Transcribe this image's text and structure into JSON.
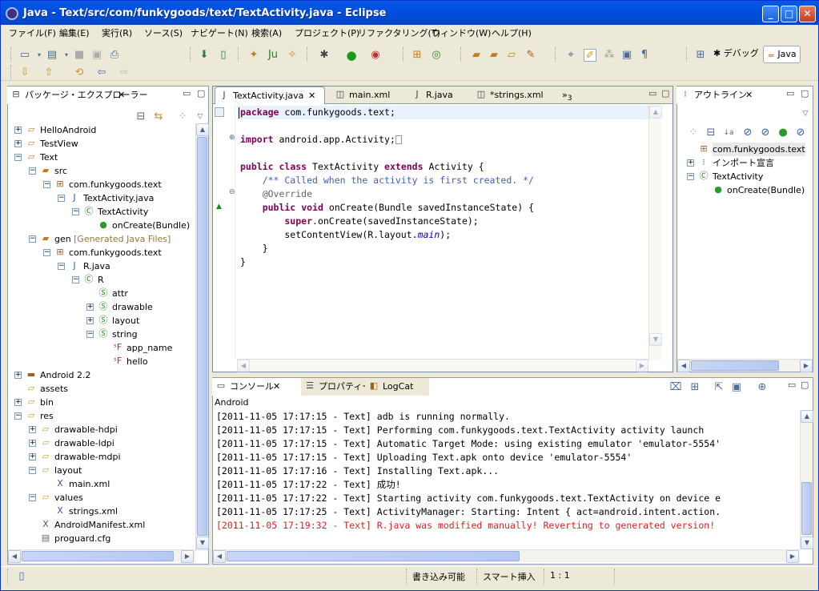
{
  "window": {
    "title": "Java - Text/src/com/funkygoods/text/TextActivity.java - Eclipse",
    "minimize": "_",
    "maximize": "□",
    "close": "✕"
  },
  "menu": [
    "ファイル(F)",
    "編集(E)",
    "実行(R)",
    "ソース(S)",
    "ナビゲート(N)",
    "検索(A)",
    "プロジェクト(P)",
    "リファクタリング(T)",
    "ウィンドウ(W)",
    "ヘルプ(H)"
  ],
  "perspectives": {
    "debug": "デバッグ",
    "java": "Java"
  },
  "explorer": {
    "title": "パッケージ・エクスプローラー",
    "items": [
      {
        "label": "HelloAndroid",
        "exp": "+",
        "icon": "project-icon"
      },
      {
        "label": "TestView",
        "exp": "+",
        "icon": "project-icon"
      },
      {
        "label": "Text",
        "exp": "−",
        "icon": "project-icon"
      },
      {
        "label": "src",
        "exp": "−",
        "icon": "source-folder-icon"
      },
      {
        "label": "com.funkygoods.text",
        "exp": "−",
        "icon": "package-icon"
      },
      {
        "label": "TextActivity.java",
        "exp": "−",
        "icon": "java-file-icon"
      },
      {
        "label": "TextActivity",
        "exp": "−",
        "icon": "class-icon"
      },
      {
        "label": "onCreate(Bundle)",
        "exp": "",
        "icon": "method-icon"
      },
      {
        "label": "gen",
        "extra": "[Generated Java Files]",
        "exp": "−",
        "icon": "source-folder-icon"
      },
      {
        "label": "com.funkygoods.text",
        "exp": "−",
        "icon": "package-icon"
      },
      {
        "label": "R.java",
        "exp": "−",
        "icon": "java-file-icon"
      },
      {
        "label": "R",
        "exp": "−",
        "icon": "class-icon"
      },
      {
        "label": "attr",
        "exp": "",
        "icon": "static-class-icon"
      },
      {
        "label": "drawable",
        "exp": "+",
        "icon": "static-class-icon"
      },
      {
        "label": "layout",
        "exp": "+",
        "icon": "static-class-icon"
      },
      {
        "label": "string",
        "exp": "−",
        "icon": "static-class-icon"
      },
      {
        "label": "app_name",
        "exp": "",
        "icon": "static-field-icon"
      },
      {
        "label": "hello",
        "exp": "",
        "icon": "static-field-icon"
      },
      {
        "label": "Android 2.2",
        "exp": "+",
        "icon": "library-icon"
      },
      {
        "label": "assets",
        "exp": "",
        "icon": "folder-icon"
      },
      {
        "label": "bin",
        "exp": "+",
        "icon": "folder-icon"
      },
      {
        "label": "res",
        "exp": "−",
        "icon": "folder-icon"
      },
      {
        "label": "drawable-hdpi",
        "exp": "+",
        "icon": "folder-icon"
      },
      {
        "label": "drawable-ldpi",
        "exp": "+",
        "icon": "folder-icon"
      },
      {
        "label": "drawable-mdpi",
        "exp": "+",
        "icon": "folder-icon"
      },
      {
        "label": "layout",
        "exp": "−",
        "icon": "folder-icon"
      },
      {
        "label": "main.xml",
        "exp": "",
        "icon": "xml-file-icon"
      },
      {
        "label": "values",
        "exp": "−",
        "icon": "folder-icon"
      },
      {
        "label": "strings.xml",
        "exp": "",
        "icon": "xml-file-icon"
      },
      {
        "label": "AndroidManifest.xml",
        "exp": "",
        "icon": "xml-file-icon"
      },
      {
        "label": "proguard.cfg",
        "exp": "",
        "icon": "file-icon"
      }
    ]
  },
  "editor": {
    "tabs": [
      {
        "label": "TextActivity.java",
        "close": "✕"
      },
      {
        "label": "main.xml"
      },
      {
        "label": "R.java"
      },
      {
        "label": "*strings.xml"
      }
    ],
    "overflow": "»",
    "overflow_count": "3",
    "code": {
      "l1_kw": "package",
      "l1_rest": " com.funkygoods.text;",
      "l3_kw": "import",
      "l3_rest": " android.app.Activity;",
      "l5_kw1": "public",
      "l5_kw2": "class",
      "l5_name": " TextActivity ",
      "l5_kw3": "extends",
      "l5_rest": " Activity {",
      "l6_comment": "    /** Called when the activity is first created. */",
      "l7_ann": "    @Override",
      "l8_kw1": "    public",
      "l8_kw2": "void",
      "l8_rest": " onCreate(Bundle savedInstanceState) {",
      "l9_kw": "        super",
      "l9_rest": ".onCreate(savedInstanceState);",
      "l10_pre": "        setContentView(R.layout.",
      "l10_it": "main",
      "l10_post": ");",
      "l11": "    }",
      "l12": "}"
    }
  },
  "outline": {
    "title": "アウトライン",
    "items": [
      {
        "label": "com.funkygoods.text",
        "exp": "",
        "icon": "package-icon"
      },
      {
        "label": "インポート宣言",
        "exp": "+",
        "icon": "imports-icon"
      },
      {
        "label": "TextActivity",
        "exp": "−",
        "icon": "class-icon"
      },
      {
        "label": "onCreate(Bundle)",
        "exp": "",
        "icon": "method-icon"
      }
    ]
  },
  "console": {
    "tabs": [
      "コンソール",
      "プロパティー",
      "LogCat"
    ],
    "header": "Android",
    "lines": [
      {
        "text": "[2011-11-05 17:17:15 - Text] adb is running normally.",
        "error": false
      },
      {
        "text": "[2011-11-05 17:17:15 - Text] Performing com.funkygoods.text.TextActivity activity launch",
        "error": false
      },
      {
        "text": "[2011-11-05 17:17:15 - Text] Automatic Target Mode: using existing emulator 'emulator-5554'",
        "error": false
      },
      {
        "text": "[2011-11-05 17:17:15 - Text] Uploading Text.apk onto device 'emulator-5554'",
        "error": false
      },
      {
        "text": "[2011-11-05 17:17:16 - Text] Installing Text.apk...",
        "error": false
      },
      {
        "text": "[2011-11-05 17:17:22 - Text] 成功!",
        "error": false
      },
      {
        "text": "[2011-11-05 17:17:22 - Text] Starting activity com.funkygoods.text.TextActivity on device e",
        "error": false
      },
      {
        "text": "[2011-11-05 17:17:25 - Text] ActivityManager: Starting: Intent { act=android.intent.action.",
        "error": false
      },
      {
        "text": "[2011-11-05 17:19:32 - Text] R.java was modified manually! Reverting to generated version!",
        "error": true
      }
    ]
  },
  "status": {
    "writable": "書き込み可能",
    "insert": "スマート挿入",
    "position": "1 : 1"
  },
  "colors": {
    "keyword": "#7f0055",
    "comment": "#3f5fbf",
    "error": "#e02020",
    "gen": "#8f7a3a"
  }
}
